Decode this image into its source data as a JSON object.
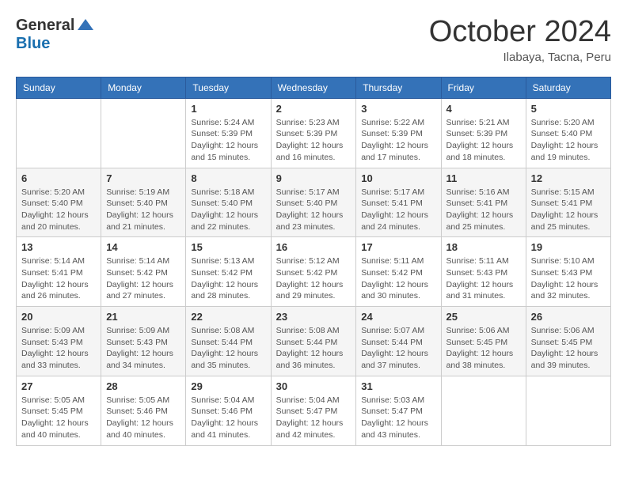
{
  "logo": {
    "general": "General",
    "blue": "Blue"
  },
  "title": "October 2024",
  "location": "Ilabaya, Tacna, Peru",
  "days_of_week": [
    "Sunday",
    "Monday",
    "Tuesday",
    "Wednesday",
    "Thursday",
    "Friday",
    "Saturday"
  ],
  "weeks": [
    [
      {
        "day": "",
        "info": ""
      },
      {
        "day": "",
        "info": ""
      },
      {
        "day": "1",
        "info": "Sunrise: 5:24 AM\nSunset: 5:39 PM\nDaylight: 12 hours and 15 minutes."
      },
      {
        "day": "2",
        "info": "Sunrise: 5:23 AM\nSunset: 5:39 PM\nDaylight: 12 hours and 16 minutes."
      },
      {
        "day": "3",
        "info": "Sunrise: 5:22 AM\nSunset: 5:39 PM\nDaylight: 12 hours and 17 minutes."
      },
      {
        "day": "4",
        "info": "Sunrise: 5:21 AM\nSunset: 5:39 PM\nDaylight: 12 hours and 18 minutes."
      },
      {
        "day": "5",
        "info": "Sunrise: 5:20 AM\nSunset: 5:40 PM\nDaylight: 12 hours and 19 minutes."
      }
    ],
    [
      {
        "day": "6",
        "info": "Sunrise: 5:20 AM\nSunset: 5:40 PM\nDaylight: 12 hours and 20 minutes."
      },
      {
        "day": "7",
        "info": "Sunrise: 5:19 AM\nSunset: 5:40 PM\nDaylight: 12 hours and 21 minutes."
      },
      {
        "day": "8",
        "info": "Sunrise: 5:18 AM\nSunset: 5:40 PM\nDaylight: 12 hours and 22 minutes."
      },
      {
        "day": "9",
        "info": "Sunrise: 5:17 AM\nSunset: 5:40 PM\nDaylight: 12 hours and 23 minutes."
      },
      {
        "day": "10",
        "info": "Sunrise: 5:17 AM\nSunset: 5:41 PM\nDaylight: 12 hours and 24 minutes."
      },
      {
        "day": "11",
        "info": "Sunrise: 5:16 AM\nSunset: 5:41 PM\nDaylight: 12 hours and 25 minutes."
      },
      {
        "day": "12",
        "info": "Sunrise: 5:15 AM\nSunset: 5:41 PM\nDaylight: 12 hours and 25 minutes."
      }
    ],
    [
      {
        "day": "13",
        "info": "Sunrise: 5:14 AM\nSunset: 5:41 PM\nDaylight: 12 hours and 26 minutes."
      },
      {
        "day": "14",
        "info": "Sunrise: 5:14 AM\nSunset: 5:42 PM\nDaylight: 12 hours and 27 minutes."
      },
      {
        "day": "15",
        "info": "Sunrise: 5:13 AM\nSunset: 5:42 PM\nDaylight: 12 hours and 28 minutes."
      },
      {
        "day": "16",
        "info": "Sunrise: 5:12 AM\nSunset: 5:42 PM\nDaylight: 12 hours and 29 minutes."
      },
      {
        "day": "17",
        "info": "Sunrise: 5:11 AM\nSunset: 5:42 PM\nDaylight: 12 hours and 30 minutes."
      },
      {
        "day": "18",
        "info": "Sunrise: 5:11 AM\nSunset: 5:43 PM\nDaylight: 12 hours and 31 minutes."
      },
      {
        "day": "19",
        "info": "Sunrise: 5:10 AM\nSunset: 5:43 PM\nDaylight: 12 hours and 32 minutes."
      }
    ],
    [
      {
        "day": "20",
        "info": "Sunrise: 5:09 AM\nSunset: 5:43 PM\nDaylight: 12 hours and 33 minutes."
      },
      {
        "day": "21",
        "info": "Sunrise: 5:09 AM\nSunset: 5:43 PM\nDaylight: 12 hours and 34 minutes."
      },
      {
        "day": "22",
        "info": "Sunrise: 5:08 AM\nSunset: 5:44 PM\nDaylight: 12 hours and 35 minutes."
      },
      {
        "day": "23",
        "info": "Sunrise: 5:08 AM\nSunset: 5:44 PM\nDaylight: 12 hours and 36 minutes."
      },
      {
        "day": "24",
        "info": "Sunrise: 5:07 AM\nSunset: 5:44 PM\nDaylight: 12 hours and 37 minutes."
      },
      {
        "day": "25",
        "info": "Sunrise: 5:06 AM\nSunset: 5:45 PM\nDaylight: 12 hours and 38 minutes."
      },
      {
        "day": "26",
        "info": "Sunrise: 5:06 AM\nSunset: 5:45 PM\nDaylight: 12 hours and 39 minutes."
      }
    ],
    [
      {
        "day": "27",
        "info": "Sunrise: 5:05 AM\nSunset: 5:45 PM\nDaylight: 12 hours and 40 minutes."
      },
      {
        "day": "28",
        "info": "Sunrise: 5:05 AM\nSunset: 5:46 PM\nDaylight: 12 hours and 40 minutes."
      },
      {
        "day": "29",
        "info": "Sunrise: 5:04 AM\nSunset: 5:46 PM\nDaylight: 12 hours and 41 minutes."
      },
      {
        "day": "30",
        "info": "Sunrise: 5:04 AM\nSunset: 5:47 PM\nDaylight: 12 hours and 42 minutes."
      },
      {
        "day": "31",
        "info": "Sunrise: 5:03 AM\nSunset: 5:47 PM\nDaylight: 12 hours and 43 minutes."
      },
      {
        "day": "",
        "info": ""
      },
      {
        "day": "",
        "info": ""
      }
    ]
  ]
}
